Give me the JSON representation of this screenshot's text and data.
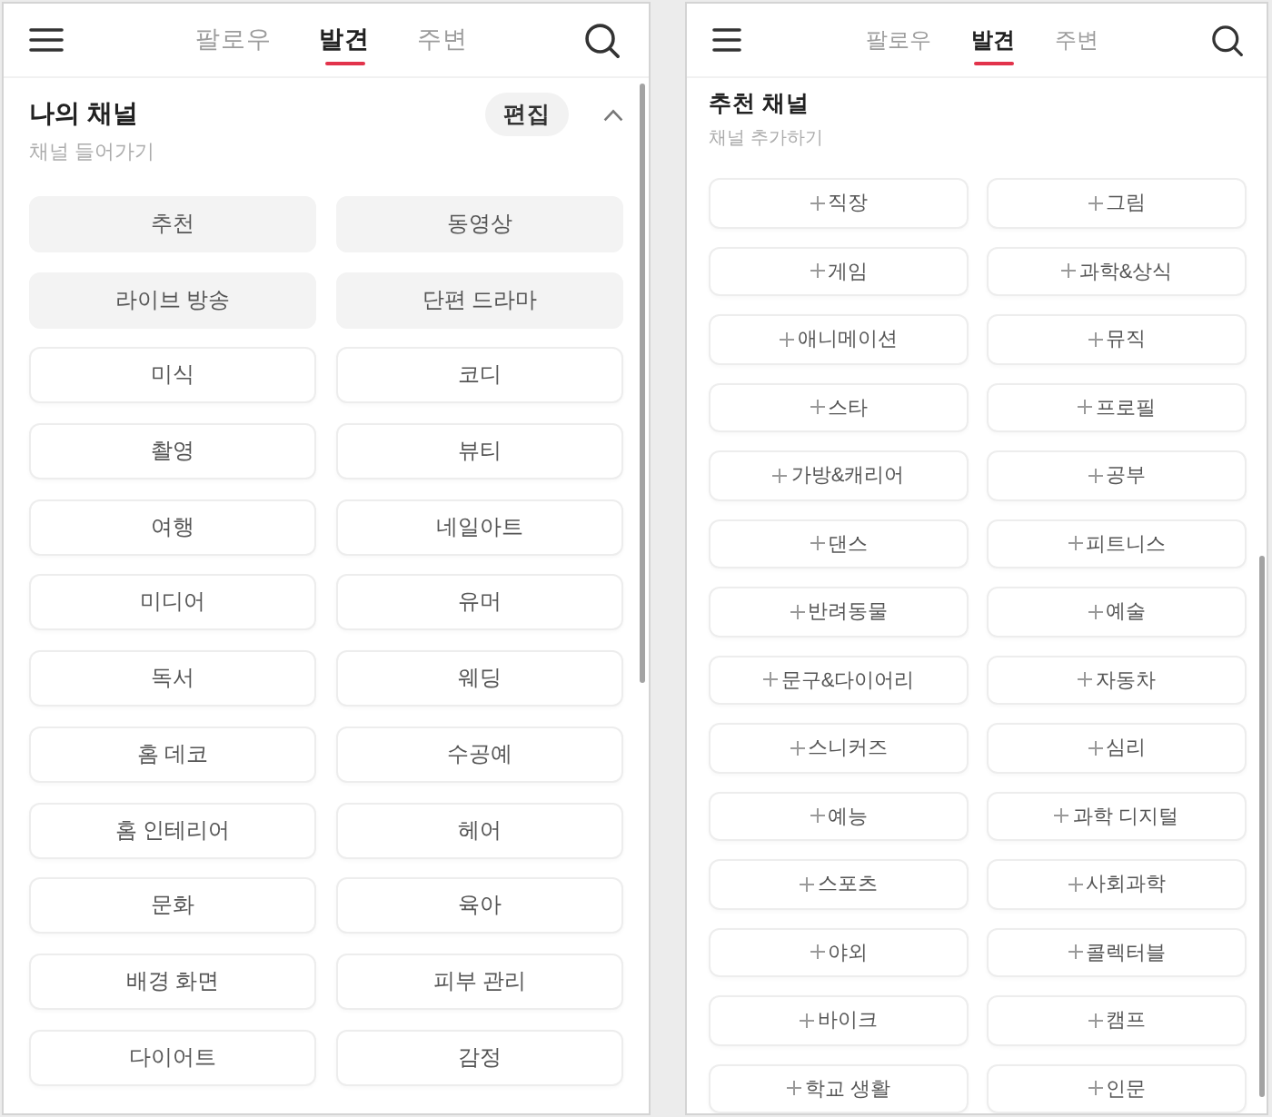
{
  "screens": [
    {
      "header": {
        "tabs": [
          {
            "label": "팔로우",
            "selected": false
          },
          {
            "label": "발견",
            "selected": true
          },
          {
            "label": "주변",
            "selected": false
          }
        ]
      },
      "section": {
        "kind": "my_channels",
        "title": "나의 채널",
        "subtitle": "채널 들어가기",
        "edit_button": "편집",
        "expanded": true
      },
      "channels": [
        {
          "label": "추천",
          "fixed": true
        },
        {
          "label": "동영상",
          "fixed": true
        },
        {
          "label": "라이브 방송",
          "fixed": true
        },
        {
          "label": "단편 드라마",
          "fixed": true
        },
        {
          "label": "미식",
          "fixed": false
        },
        {
          "label": "코디",
          "fixed": false
        },
        {
          "label": "촬영",
          "fixed": false
        },
        {
          "label": "뷰티",
          "fixed": false
        },
        {
          "label": "여행",
          "fixed": false
        },
        {
          "label": "네일아트",
          "fixed": false
        },
        {
          "label": "미디어",
          "fixed": false
        },
        {
          "label": "유머",
          "fixed": false
        },
        {
          "label": "독서",
          "fixed": false
        },
        {
          "label": "웨딩",
          "fixed": false
        },
        {
          "label": "홈 데코",
          "fixed": false
        },
        {
          "label": "수공예",
          "fixed": false
        },
        {
          "label": "홈 인테리어",
          "fixed": false
        },
        {
          "label": "헤어",
          "fixed": false
        },
        {
          "label": "문화",
          "fixed": false
        },
        {
          "label": "육아",
          "fixed": false
        },
        {
          "label": "배경 화면",
          "fixed": false
        },
        {
          "label": "피부 관리",
          "fixed": false
        },
        {
          "label": "다이어트",
          "fixed": false
        },
        {
          "label": "감정",
          "fixed": false
        }
      ]
    },
    {
      "header": {
        "tabs": [
          {
            "label": "팔로우",
            "selected": false
          },
          {
            "label": "발견",
            "selected": true
          },
          {
            "label": "주변",
            "selected": false
          }
        ]
      },
      "section": {
        "kind": "recommended",
        "title": "추천 채널",
        "subtitle": "채널 추가하기"
      },
      "channels": [
        {
          "label": "직장"
        },
        {
          "label": "그림"
        },
        {
          "label": "게임"
        },
        {
          "label": "과학&상식"
        },
        {
          "label": "애니메이션"
        },
        {
          "label": "뮤직"
        },
        {
          "label": "스타"
        },
        {
          "label": "프로필"
        },
        {
          "label": "가방&캐리어"
        },
        {
          "label": "공부"
        },
        {
          "label": "댄스"
        },
        {
          "label": "피트니스"
        },
        {
          "label": "반려동물"
        },
        {
          "label": "예술"
        },
        {
          "label": "문구&다이어리"
        },
        {
          "label": "자동차"
        },
        {
          "label": "스니커즈"
        },
        {
          "label": "심리"
        },
        {
          "label": "예능"
        },
        {
          "label": "과학 디지털"
        },
        {
          "label": "스포츠"
        },
        {
          "label": "사회과학"
        },
        {
          "label": "야외"
        },
        {
          "label": "콜렉터블"
        },
        {
          "label": "바이크"
        },
        {
          "label": "캠프"
        },
        {
          "label": "학교 생활"
        },
        {
          "label": "인문"
        }
      ]
    }
  ]
}
